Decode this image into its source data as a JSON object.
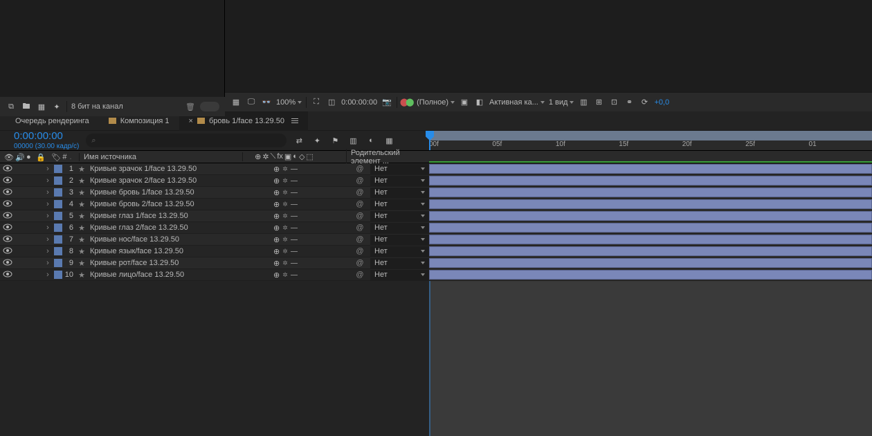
{
  "project_toolbar": {
    "bpc_label": "8 бит на канал"
  },
  "preview_toolbar": {
    "zoom": "100%",
    "timecode": "0:00:00:00",
    "resolution": "(Полное)",
    "camera": "Активная ка...",
    "views": "1 вид",
    "exposure": "+0,0"
  },
  "tabs": [
    {
      "label": "Очередь рендеринга",
      "active": false,
      "has_icon": false
    },
    {
      "label": "Композиция 1",
      "active": false,
      "has_icon": true
    },
    {
      "label": "бровь 1/face 13.29.50",
      "active": true,
      "has_icon": true
    }
  ],
  "timecode": {
    "big": "0:00:00:00",
    "small": "00000 (30.00 кадр/с)"
  },
  "search_placeholder": "",
  "columns": {
    "name": "Имя источника",
    "num": "#",
    "parent": "Родительский элемент ..."
  },
  "parent_none": "Нет",
  "layers": [
    {
      "name": "Кривые зрачок 1/face 13.29.50"
    },
    {
      "name": "Кривые зрачок 2/face 13.29.50"
    },
    {
      "name": "Кривые бровь 1/face 13.29.50"
    },
    {
      "name": "Кривые бровь 2/face 13.29.50"
    },
    {
      "name": "Кривые глаз 1/face 13.29.50"
    },
    {
      "name": "Кривые глаз 2/face 13.29.50"
    },
    {
      "name": "Кривые нос/face 13.29.50"
    },
    {
      "name": "Кривые язык/face 13.29.50"
    },
    {
      "name": "Кривые рот/face 13.29.50"
    },
    {
      "name": "Кривые лицо/face 13.29.50"
    }
  ],
  "ruler_ticks": [
    "00f",
    "05f",
    "10f",
    "15f",
    "20f",
    "25f",
    "01"
  ]
}
